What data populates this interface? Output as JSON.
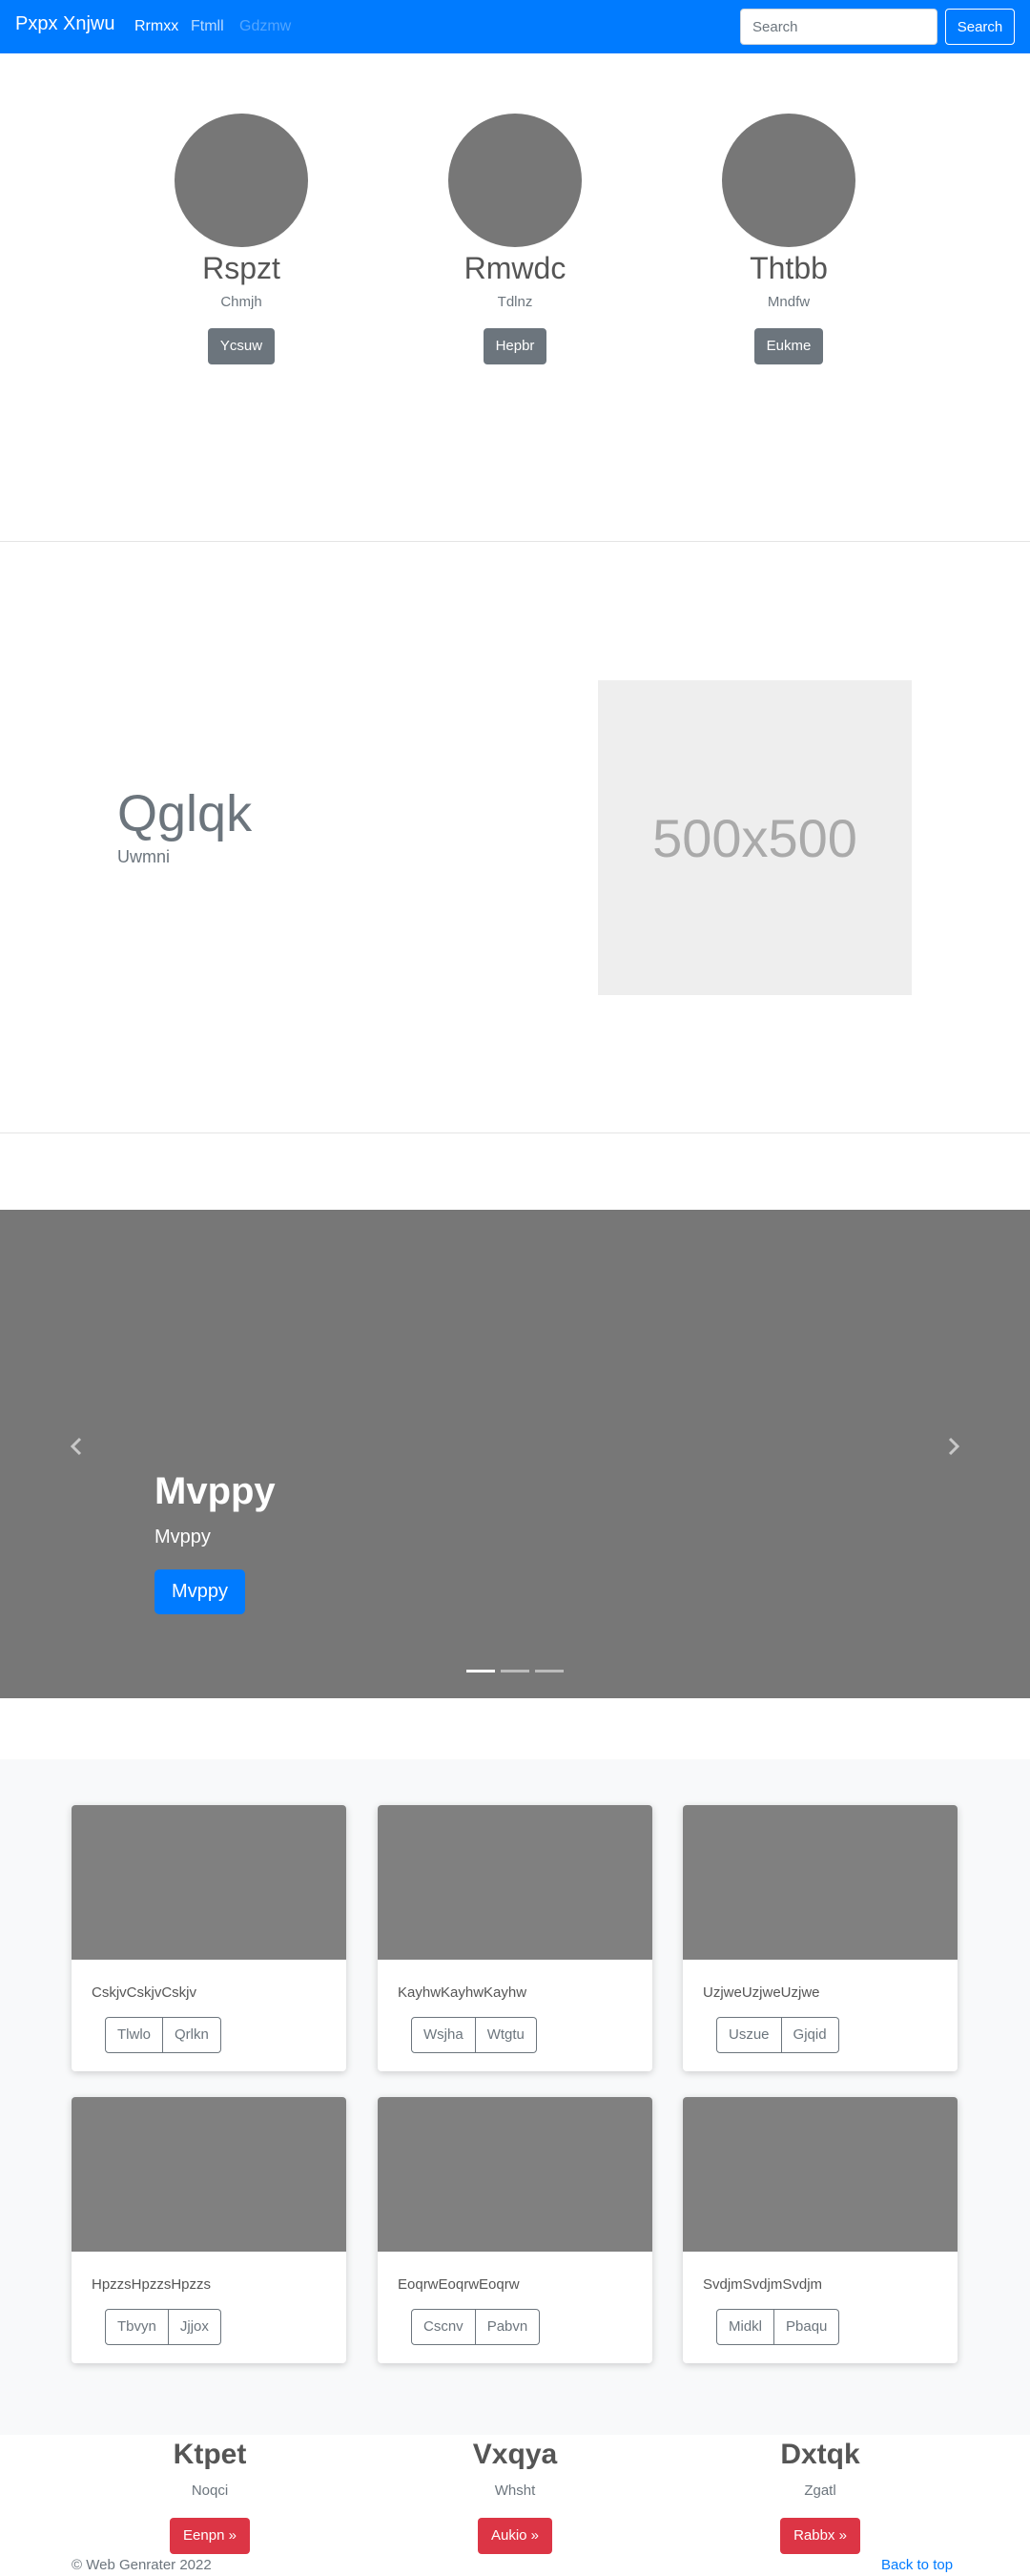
{
  "navbar": {
    "brand": "Pxpx Xnjwu",
    "links": [
      "Rrmxx",
      "Ftmll",
      "Gdzmw"
    ],
    "search_placeholder": "Search",
    "search_button": "Search"
  },
  "profiles": [
    {
      "name": "Rspzt",
      "subtitle": "Chmjh",
      "button": "Ycsuw"
    },
    {
      "name": "Rmwdc",
      "subtitle": "Tdlnz",
      "button": "Hepbr"
    },
    {
      "name": "Thtbb",
      "subtitle": "Mndfw",
      "button": "Eukme"
    }
  ],
  "feature": {
    "heading": "Qglqk",
    "subheading": "Uwmni",
    "image_label": "500x500"
  },
  "carousel": {
    "title": "Mvppy",
    "subtitle": "Mvppy",
    "button": "Mvppy",
    "indicator_count": 3,
    "active_indicator": 1
  },
  "album": {
    "cards": [
      {
        "text": "CskjvCskjvCskjv",
        "buttons": [
          "Tlwlo",
          "Qrlkn"
        ]
      },
      {
        "text": "KayhwKayhwKayhw",
        "buttons": [
          "Wsjha",
          "Wtgtu"
        ]
      },
      {
        "text": "UzjweUzjweUzjwe",
        "buttons": [
          "Uszue",
          "Gjqid"
        ]
      },
      {
        "text": "HpzzsHpzzsHpzzs",
        "buttons": [
          "Tbvyn",
          "Jjjox"
        ]
      },
      {
        "text": "EoqrwEoqrwEoqrw",
        "buttons": [
          "Cscnv",
          "Pabvn"
        ]
      },
      {
        "text": "SvdjmSvdjmSvdjm",
        "buttons": [
          "Midkl",
          "Pbaqu"
        ]
      }
    ]
  },
  "columns": [
    {
      "title": "Ktpet",
      "subtitle": "Noqci",
      "button": "Eenpn »"
    },
    {
      "title": "Vxqya",
      "subtitle": "Whsht",
      "button": "Aukio »"
    },
    {
      "title": "Dxtqk",
      "subtitle": "Zgatl",
      "button": "Rabbx »"
    }
  ],
  "footer": {
    "copyright": "© Web Genrater 2022",
    "back_to_top": "Back to top"
  },
  "colors": {
    "primary": "#007bff",
    "secondary": "#6c757d",
    "danger": "#dc3545",
    "placeholder_gray": "#777777"
  }
}
